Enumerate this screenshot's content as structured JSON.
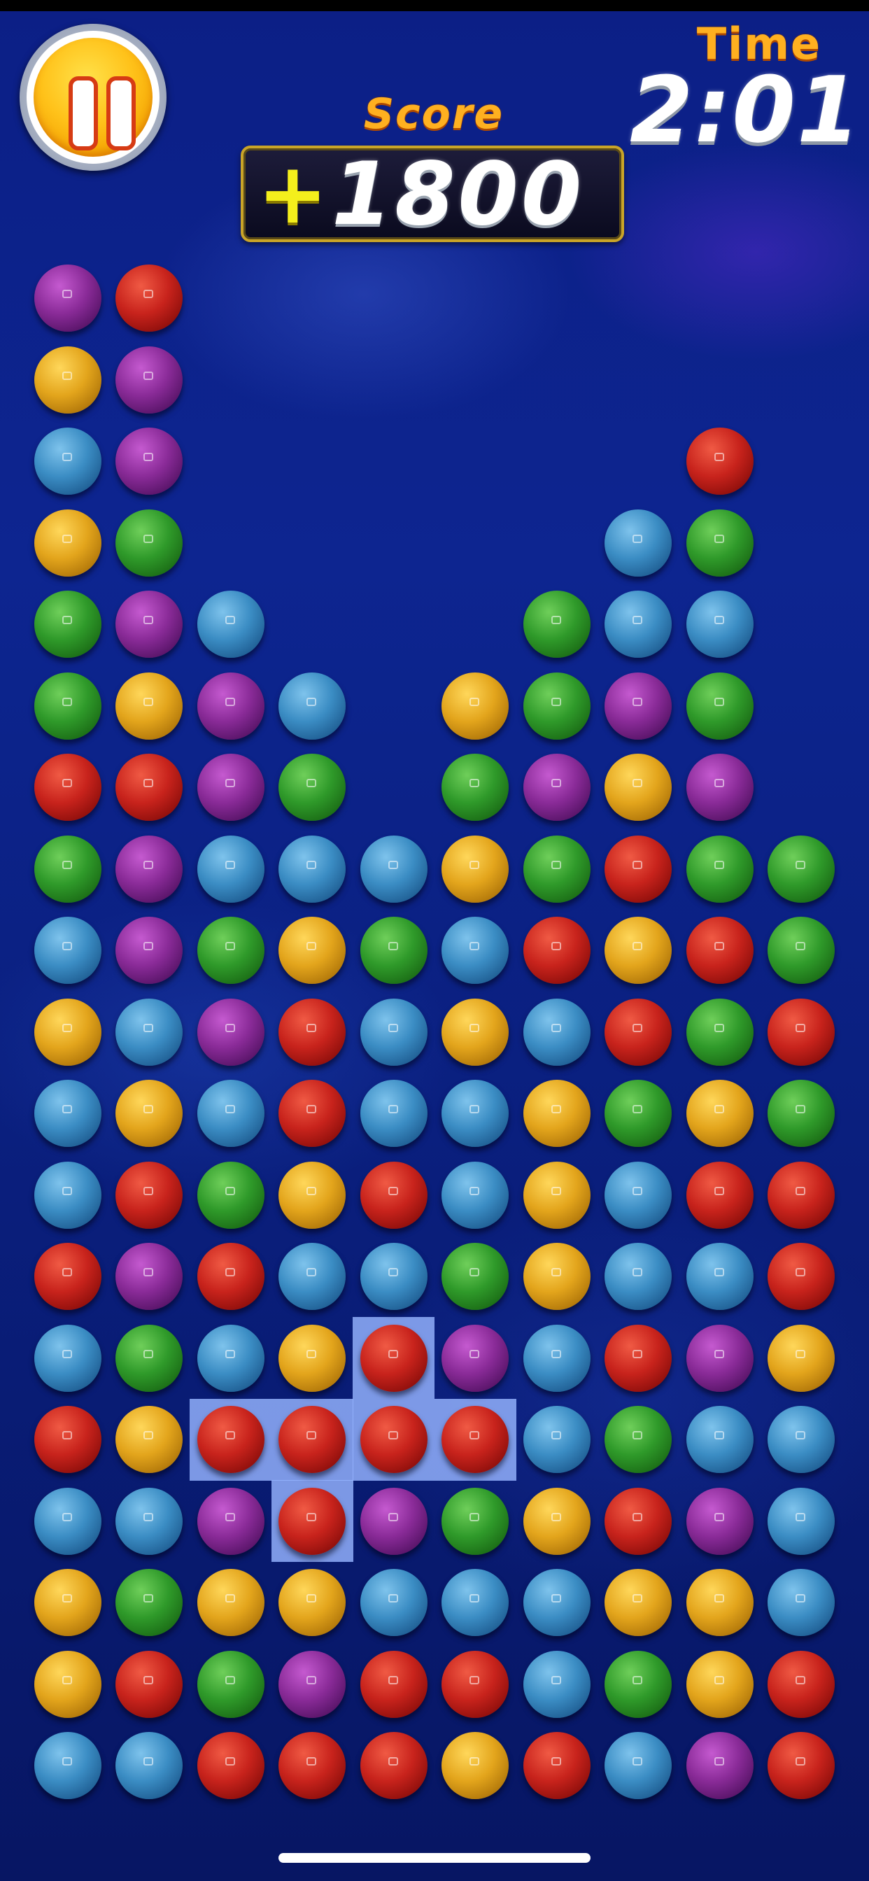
{
  "hud": {
    "pause_icon": "pause-icon",
    "score_label": "Score",
    "score_prefix": "+",
    "score_value": "1800",
    "time_label": "Time",
    "time_value": "2:01"
  },
  "colors": {
    "purple": "#8a2b98",
    "red": "#c8231c",
    "yellow": "#e3a51c",
    "blue": "#3b8dc4",
    "green": "#2f9a2a",
    "highlight": "#96b4ff"
  },
  "board": {
    "columns": 10,
    "rows": 19,
    "grid": [
      [
        "purple",
        "red",
        null,
        null,
        null,
        null,
        null,
        null,
        null,
        null
      ],
      [
        "yellow",
        "purple",
        null,
        null,
        null,
        null,
        null,
        null,
        null,
        null
      ],
      [
        "blue",
        "purple",
        null,
        null,
        null,
        null,
        null,
        null,
        "red",
        null
      ],
      [
        "yellow",
        "green",
        null,
        null,
        null,
        null,
        null,
        "blue",
        "green",
        null
      ],
      [
        "green",
        "purple",
        "blue",
        null,
        null,
        null,
        "green",
        "blue",
        "blue",
        null
      ],
      [
        "green",
        "yellow",
        "purple",
        "blue",
        null,
        "yellow",
        "green",
        "purple",
        "green",
        null
      ],
      [
        "red",
        "red",
        "purple",
        "green",
        null,
        "green",
        "purple",
        "yellow",
        "purple",
        null
      ],
      [
        "green",
        "purple",
        "blue",
        "blue",
        "blue",
        "yellow",
        "green",
        "red",
        "green",
        "green"
      ],
      [
        "blue",
        "purple",
        "green",
        "yellow",
        "green",
        "blue",
        "red",
        "yellow",
        "red",
        "green"
      ],
      [
        "yellow",
        "blue",
        "purple",
        "red",
        "blue",
        "yellow",
        "blue",
        "red",
        "green",
        "red"
      ],
      [
        "blue",
        "yellow",
        "blue",
        "red",
        "blue",
        "blue",
        "yellow",
        "green",
        "yellow",
        "green"
      ],
      [
        "blue",
        "red",
        "green",
        "yellow",
        "red",
        "blue",
        "yellow",
        "blue",
        "red",
        "red"
      ],
      [
        "red",
        "purple",
        "red",
        "blue",
        "blue",
        "green",
        "yellow",
        "blue",
        "blue",
        "red"
      ],
      [
        "blue",
        "green",
        "blue",
        "yellow",
        "red",
        "purple",
        "blue",
        "red",
        "purple",
        "yellow"
      ],
      [
        "red",
        "yellow",
        "red",
        "red",
        "red",
        "red",
        "blue",
        "green",
        "blue",
        "blue"
      ],
      [
        "blue",
        "blue",
        "purple",
        "red",
        "purple",
        "green",
        "yellow",
        "red",
        "purple",
        "blue"
      ],
      [
        "yellow",
        "green",
        "yellow",
        "yellow",
        "blue",
        "blue",
        "blue",
        "yellow",
        "yellow",
        "blue"
      ],
      [
        "yellow",
        "red",
        "green",
        "purple",
        "red",
        "red",
        "blue",
        "green",
        "yellow",
        "red"
      ],
      [
        "blue",
        "blue",
        "red",
        "red",
        "red",
        "yellow",
        "red",
        "blue",
        "purple",
        "red"
      ]
    ],
    "selected_group": [
      [
        13,
        4
      ],
      [
        14,
        2
      ],
      [
        14,
        3
      ],
      [
        14,
        4
      ],
      [
        14,
        5
      ],
      [
        15,
        3
      ]
    ]
  }
}
